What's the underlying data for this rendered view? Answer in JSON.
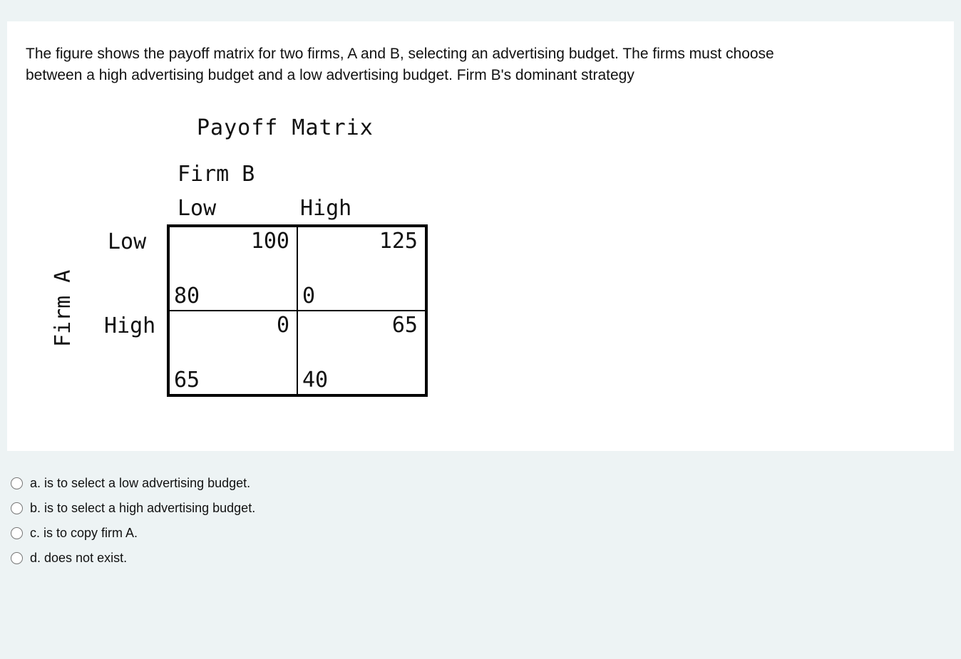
{
  "question": "The figure shows the payoff matrix for two firms, A and B, selecting an advertising budget. The firms must choose between a high advertising budget and a low advertising budget. Firm B's dominant strategy",
  "matrix": {
    "title": "Payoff Matrix",
    "colPlayer": "Firm B",
    "rowPlayer": "Firm A",
    "colLabels": {
      "low": "Low",
      "high": "High"
    },
    "rowLabels": {
      "low": "Low",
      "high": "High"
    },
    "cells": {
      "lowLow": {
        "b": "100",
        "a": "80"
      },
      "lowHigh": {
        "b": "125",
        "a": "0"
      },
      "highLow": {
        "b": "0",
        "a": "65"
      },
      "highHigh": {
        "b": "65",
        "a": "40"
      }
    }
  },
  "options": {
    "a": "a. is to select a low advertising budget.",
    "b": "b. is to select a high advertising budget.",
    "c": "c. is to copy firm A.",
    "d": "d. does not exist."
  }
}
